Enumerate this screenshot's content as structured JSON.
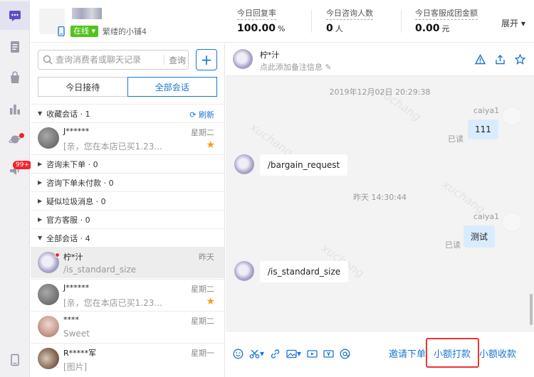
{
  "sidebar": {
    "icons": [
      "chat-icon",
      "document-icon",
      "shopping-bag-icon",
      "bar-chart-icon",
      "planet-icon",
      "speaker-icon",
      "tablet-icon"
    ],
    "badge": "99+",
    "accent": "#1976d2"
  },
  "header": {
    "status": "在线",
    "sub_account": "繁缕的小铺4",
    "stats": [
      {
        "label": "今日回复率",
        "value": "100.00",
        "unit": "%"
      },
      {
        "label": "今日咨询人数",
        "value": "0",
        "unit": "人"
      },
      {
        "label": "今日客服成团金额",
        "value": "0.00",
        "unit": "元"
      }
    ],
    "expand": "展开"
  },
  "list": {
    "search_placeholder": "查询消费者或聊天记录",
    "search_button": "查询",
    "tabs": [
      "今日接待",
      "全部会话"
    ],
    "groups": {
      "favorites": "收藏会话 · 1",
      "refresh": "刷新",
      "no_order": "咨询未下单 · 0",
      "unpaid": "咨询下单未付款 · 0",
      "spam": "疑似垃圾消息 · 0",
      "official": "官方客服 · 0",
      "all": "全部会话 · 4"
    },
    "favorite_items": [
      {
        "name": "J******",
        "preview": "[亲，您在本店已买1.23...",
        "time": "星期二"
      }
    ],
    "all_items": [
      {
        "name": "柠*汁",
        "preview": "/is_standard_size",
        "time": "昨天"
      },
      {
        "name": "J******",
        "preview": "[亲，您在本店已买1.23...",
        "time": "星期二"
      },
      {
        "name": "****",
        "preview": "Sweet",
        "time": "星期二"
      },
      {
        "name": "R*****军",
        "preview": "[图片]",
        "time": "星期一"
      }
    ]
  },
  "chat": {
    "title": "柠*汁",
    "note_placeholder": "点此添加备注信息",
    "messages": [
      {
        "type": "timestamp",
        "text": "2019年12月02日 20:29:38"
      },
      {
        "type": "sent",
        "sender": "caiya1",
        "text": "111",
        "status": "已读"
      },
      {
        "type": "received",
        "text": "/bargain_request"
      },
      {
        "type": "timestamp",
        "text": "昨天 14:30:44"
      },
      {
        "type": "sent",
        "sender": "caiya1",
        "text": "测试",
        "status": "已读"
      },
      {
        "type": "received",
        "text": "/is_standard_size"
      }
    ],
    "watermark": "xuchang",
    "actions": {
      "invite_order": "邀请下单",
      "small_pay": "小额打款",
      "small_collect": "小额收款"
    },
    "highlight_color": "#e33333"
  }
}
